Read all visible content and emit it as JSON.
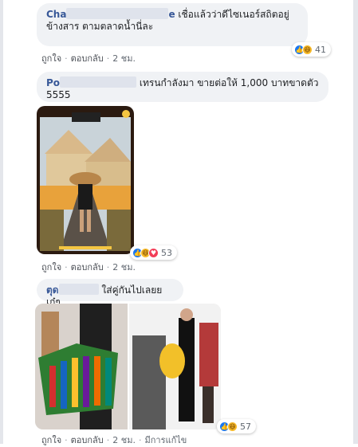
{
  "comments": [
    {
      "name": "Cha",
      "name_suffix": "e",
      "text": "เชื่อแล้วว่าดีไซเนอร์สถิตอยู่ข้างสาร ตามตลาดน้ำนี่ละ",
      "actions": {
        "like": "ถูกใจ",
        "reply": "ตอบกลับ",
        "time": "2 ชม."
      },
      "reactions": {
        "icons": [
          "like-icon",
          "haha-icon"
        ],
        "count": "41"
      }
    },
    {
      "name": "Po",
      "text": "เทรนกำลังมา ขายต่อให้ 1,000 บาทขาดตัว 5555",
      "actions": {
        "like": "ถูกใจ",
        "reply": "ตอบกลับ",
        "time": "2 ชม."
      },
      "reactions": {
        "icons": [
          "like-icon",
          "haha-icon",
          "love-icon"
        ],
        "count": "53"
      }
    },
    {
      "name": "ตุด",
      "text": "ใส่คู่กันไปเลยย เก๋ๆ",
      "actions": {
        "like": "ถูกใจ",
        "reply": "ตอบกลับ",
        "time": "2 ชม.",
        "edited": "มีการแก้ไข"
      },
      "reactions": {
        "icons": [
          "like-icon",
          "haha-icon"
        ],
        "count": "57"
      }
    }
  ],
  "colors": {
    "name": "#385898",
    "bubble": "#f0f2f5",
    "like": "#1877f2",
    "haha": "#f7b928",
    "love": "#f33e58"
  }
}
